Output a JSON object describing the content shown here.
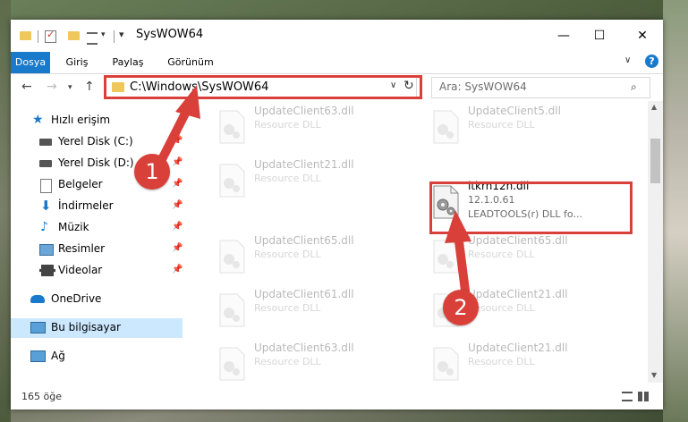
{
  "window": {
    "title": "SysWOW64",
    "minimize_glyph": "—",
    "maximize_glyph": "☐",
    "close_glyph": "✕"
  },
  "ribbon": {
    "tabs": [
      "Dosya",
      "Giriş",
      "Paylaş",
      "Görünüm"
    ],
    "active_tab": "Dosya",
    "accent": "#1979ca",
    "help_glyph": "?"
  },
  "address": {
    "path": "C:\\Windows\\SysWOW64",
    "search_placeholder": "Ara: SysWOW64"
  },
  "sidebar": {
    "items": [
      {
        "label": "Hızlı erişim",
        "icon": "star-icon"
      },
      {
        "label": "Yerel Disk (C:)",
        "icon": "drive-icon",
        "pinned": true
      },
      {
        "label": "Yerel Disk (D:)",
        "icon": "drive-icon",
        "pinned": true
      },
      {
        "label": "Belgeler",
        "icon": "documents-icon",
        "pinned": true
      },
      {
        "label": "İndirmeler",
        "icon": "download-icon",
        "pinned": true
      },
      {
        "label": "Müzik",
        "icon": "music-icon",
        "pinned": true
      },
      {
        "label": "Resimler",
        "icon": "pictures-icon",
        "pinned": true
      },
      {
        "label": "Videolar",
        "icon": "video-icon",
        "pinned": true
      },
      {
        "label": "OneDrive",
        "icon": "cloud-icon"
      },
      {
        "label": "Bu bilgisayar",
        "icon": "computer-icon",
        "selected": true
      },
      {
        "label": "Ağ",
        "icon": "network-icon"
      }
    ]
  },
  "files": [
    {
      "name": "UpdateClient63.dll",
      "sub": "Resource DLL",
      "faded": true
    },
    {
      "name": "UpdateClient5.dll",
      "sub": "Resource DLL",
      "faded": true
    },
    {
      "name": "UpdateClient21.dll",
      "sub": "Resource DLL",
      "faded": true
    },
    {
      "name": "ltkrn12n.dll",
      "version": "12.1.0.61",
      "sub": "LEADTOOLS(r) DLL fo...",
      "faded": false
    },
    {
      "name": "UpdateClient65.dll",
      "sub": "Resource DLL",
      "faded": true
    },
    {
      "name": "UpdateClient65.dll",
      "sub": "Resource DLL",
      "faded": true
    },
    {
      "name": "UpdateClient61.dll",
      "sub": "Resource DLL",
      "faded": true
    },
    {
      "name": "UpdateClient21.dll",
      "sub": "Resource DLL",
      "faded": true
    },
    {
      "name": "UpdateClient63.dll",
      "sub": "Resource DLL",
      "faded": true
    },
    {
      "name": "UpdateClient21.dll",
      "sub": "Resource DLL",
      "faded": true
    }
  ],
  "status": {
    "item_count": "165 öğe"
  },
  "annotations": {
    "callout_1": "1",
    "callout_2": "2",
    "highlight_color": "#d9403a"
  }
}
